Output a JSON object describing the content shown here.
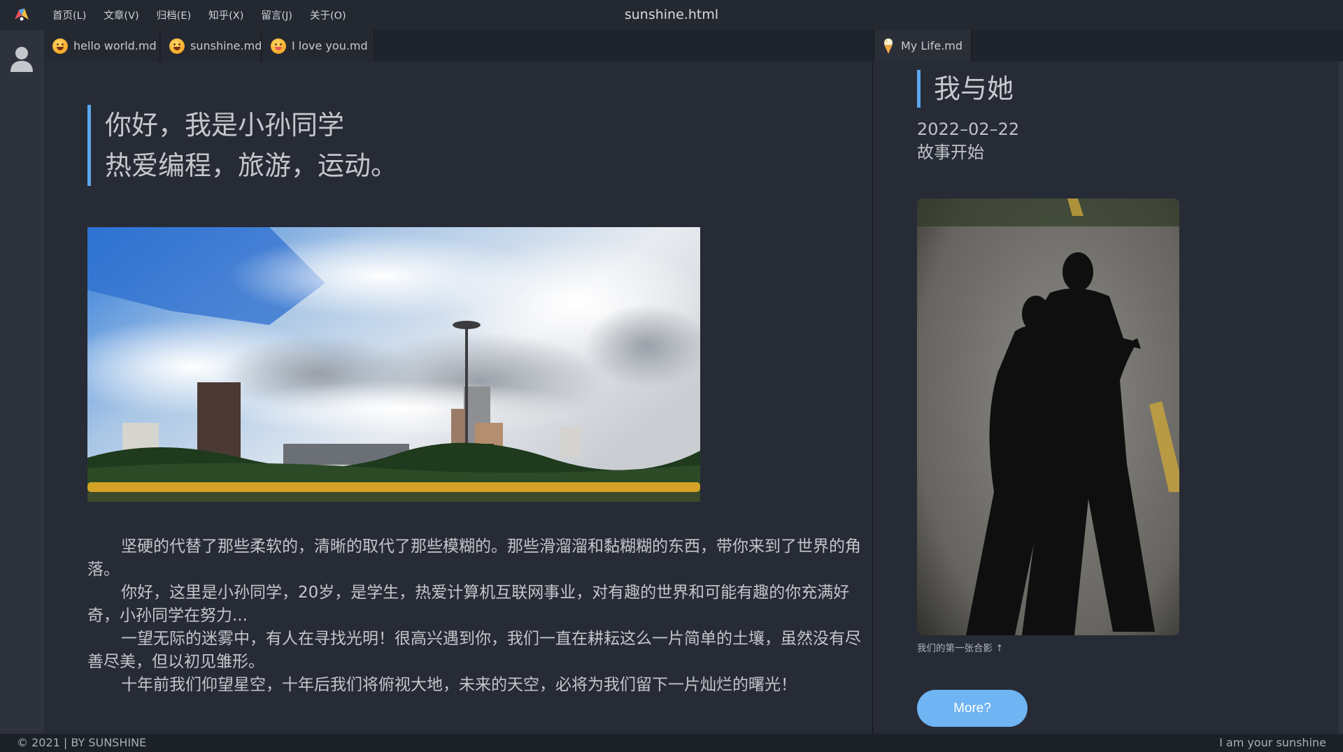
{
  "window": {
    "title": "sunshine.html"
  },
  "menu": {
    "items": [
      {
        "label": "首页(L)"
      },
      {
        "label": "文章(V)"
      },
      {
        "label": "归档(E)"
      },
      {
        "label": "知乎(X)"
      },
      {
        "label": "留言(J)"
      },
      {
        "label": "关于(O)"
      }
    ]
  },
  "tabs": [
    {
      "label": "hello world.md",
      "icon": "grin-emoji-icon"
    },
    {
      "label": "sunshine.md",
      "icon": "squint-emoji-icon"
    },
    {
      "label": "I love you.md",
      "icon": "tongue-emoji-icon"
    }
  ],
  "right_tab": {
    "label": "My Life.md",
    "icon": "ice-cream-icon"
  },
  "main": {
    "quote": [
      "你好，我是小孙同学",
      "热爱编程，旅游，运动。"
    ],
    "paragraphs": [
      "坚硬的代替了那些柔软的，清晰的取代了那些模糊的。那些滑溜溜和黏糊糊的东西，带你来到了世界的角落。",
      "你好，这里是小孙同学，20岁，是学生，热爱计算机互联网事业，对有趣的世界和可能有趣的你充满好奇，小孙同学在努力...",
      "一望无际的迷雾中，有人在寻找光明！很高兴遇到你，我们一直在耕耘这么一片简单的土壤，虽然没有尽善尽美，但以初见雏形。",
      "十年前我们仰望星空，十年后我们将俯视大地，未来的天空，必将为我们留下一片灿烂的曙光！"
    ]
  },
  "side": {
    "heading": "我与她",
    "date": "2022–02–22",
    "subtitle": "故事开始",
    "caption": "我们的第一张合影 ↑",
    "more_button": "More?"
  },
  "footer": {
    "left": "© 2021 | BY SUNSHINE",
    "right": "I am your sunshine"
  },
  "colors": {
    "accent": "#5aa8f0",
    "button": "#6fb4f3",
    "background": "#262b35",
    "menubar": "#242831"
  }
}
